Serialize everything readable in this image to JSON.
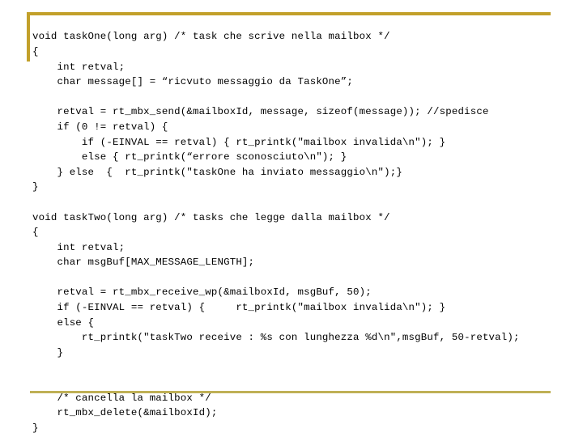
{
  "slide": {
    "kind": "code-listing-slide",
    "background_color": "#ffffff",
    "accent_color": "#c2a02a",
    "rule_color": "#bfb055",
    "text_color": "#000000",
    "language": "c",
    "topic": "RTAI mailbox tasks (taskOne writer / taskTwo reader)"
  },
  "code": {
    "lines": [
      "void taskOne(long arg) /* task che scrive nella mailbox */",
      "{",
      "    int retval;",
      "    char message[] = “ricvuto messaggio da TaskOne”;",
      "",
      "    retval = rt_mbx_send(&mailboxId, message, sizeof(message)); //spedisce",
      "    if (0 != retval) {",
      "        if (-EINVAL == retval) { rt_printk(\"mailbox invalida\\n\"); }",
      "        else { rt_printk(“errore sconosciuto\\n\"); }",
      "    } else  {  rt_printk(\"taskOne ha inviato messaggio\\n\");}",
      "}",
      "",
      "void taskTwo(long arg) /* tasks che legge dalla mailbox */",
      "{",
      "    int retval;",
      "    char msgBuf[MAX_MESSAGE_LENGTH];",
      "",
      "    retval = rt_mbx_receive_wp(&mailboxId, msgBuf, 50);",
      "    if (-EINVAL == retval) {     rt_printk(\"mailbox invalida\\n\"); }",
      "    else {",
      "        rt_printk(\"taskTwo receive : %s con lunghezza %d\\n\",msgBuf, 50-retval);",
      "    }",
      "",
      "",
      "    /* cancella la mailbox */",
      "    rt_mbx_delete(&mailboxId);",
      "}"
    ]
  }
}
